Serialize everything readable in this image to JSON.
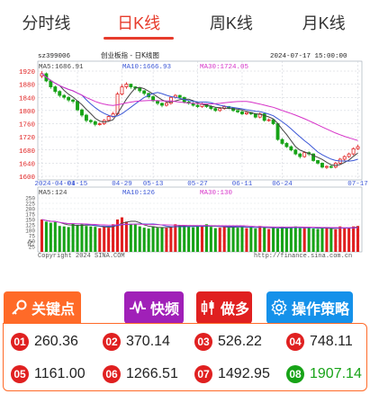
{
  "tabs": [
    {
      "label": "分时线",
      "active": false
    },
    {
      "label": "日K线",
      "active": true
    },
    {
      "label": "周K线",
      "active": false
    },
    {
      "label": "月K线",
      "active": false
    }
  ],
  "chart_header": {
    "code": "sz399006",
    "name": "创业板指 - 日K线图",
    "datetime": "2024-07-17 15:00:00",
    "ma5": "MA5:1686.91",
    "ma10": "MA10:1666.93",
    "ma30": "MA30:1724.05"
  },
  "price_axis": [
    "1920",
    "1880",
    "1840",
    "1800",
    "1760",
    "1720",
    "1680",
    "1640",
    "1600"
  ],
  "date_axis": [
    "2024-04-01",
    "04-15",
    "04-29",
    "05-13",
    "05-27",
    "06-11",
    "06-24",
    "07-17"
  ],
  "volume_header": {
    "ma5": "MA5:124",
    "ma10": "MA10:126",
    "ma30": "MA30:130"
  },
  "volume_axis": [
    "250",
    "225",
    "200",
    "175",
    "150",
    "125",
    "100",
    "75",
    "50",
    "25"
  ],
  "volume_unit": "亿",
  "copyright": "Copyright 2024 SINA.COM",
  "source_url": "http://finance.sina.com.cn",
  "toolbar": {
    "key_points": "关键点",
    "quick": "快频",
    "more": "做多",
    "strategy": "操作策略"
  },
  "key_points": [
    {
      "id": "01",
      "value": "260.36"
    },
    {
      "id": "02",
      "value": "370.14"
    },
    {
      "id": "03",
      "value": "526.22"
    },
    {
      "id": "04",
      "value": "748.11"
    },
    {
      "id": "05",
      "value": "1161.00"
    },
    {
      "id": "06",
      "value": "1266.51"
    },
    {
      "id": "07",
      "value": "1492.95"
    },
    {
      "id": "08",
      "value": "1907.14"
    }
  ],
  "colors": {
    "up": "#e02020",
    "down": "#17a317",
    "ma5": "#444444",
    "ma10": "#3a56d6",
    "ma30": "#d632c8"
  },
  "chart_data": {
    "type": "candlestick",
    "x": [
      "2024-04-01",
      "04-02",
      "04-03",
      "04-08",
      "04-09",
      "04-10",
      "04-11",
      "04-12",
      "04-15",
      "04-16",
      "04-17",
      "04-18",
      "04-19",
      "04-22",
      "04-23",
      "04-24",
      "04-25",
      "04-26",
      "04-29",
      "04-30",
      "05-06",
      "05-07",
      "05-08",
      "05-09",
      "05-10",
      "05-13",
      "05-14",
      "05-15",
      "05-16",
      "05-17",
      "05-20",
      "05-21",
      "05-22",
      "05-23",
      "05-24",
      "05-27",
      "05-28",
      "05-29",
      "05-30",
      "05-31",
      "06-03",
      "06-04",
      "06-05",
      "06-06",
      "06-07",
      "06-11",
      "06-12",
      "06-13",
      "06-14",
      "06-17",
      "06-18",
      "06-19",
      "06-20",
      "06-21",
      "06-24",
      "06-25",
      "06-26",
      "06-27",
      "06-28",
      "07-01",
      "07-02",
      "07-03",
      "07-04",
      "07-05",
      "07-08",
      "07-09",
      "07-10",
      "07-11",
      "07-12",
      "07-15",
      "07-16",
      "07-17"
    ],
    "open": [
      1905,
      1912,
      1890,
      1872,
      1858,
      1846,
      1840,
      1832,
      1828,
      1802,
      1786,
      1770,
      1766,
      1758,
      1760,
      1770,
      1782,
      1790,
      1850,
      1872,
      1880,
      1872,
      1868,
      1860,
      1852,
      1842,
      1830,
      1822,
      1816,
      1822,
      1840,
      1846,
      1840,
      1826,
      1822,
      1816,
      1812,
      1820,
      1812,
      1806,
      1800,
      1806,
      1812,
      1808,
      1800,
      1796,
      1790,
      1794,
      1790,
      1780,
      1790,
      1770,
      1772,
      1760,
      1712,
      1700,
      1690,
      1680,
      1668,
      1660,
      1672,
      1668,
      1648,
      1640,
      1628,
      1630,
      1628,
      1640,
      1652,
      1660,
      1668,
      1684
    ],
    "close": [
      1912,
      1890,
      1872,
      1858,
      1846,
      1840,
      1832,
      1828,
      1802,
      1786,
      1770,
      1766,
      1758,
      1760,
      1770,
      1782,
      1790,
      1850,
      1872,
      1880,
      1872,
      1868,
      1860,
      1852,
      1842,
      1830,
      1822,
      1816,
      1822,
      1840,
      1846,
      1840,
      1826,
      1822,
      1816,
      1812,
      1820,
      1812,
      1806,
      1800,
      1806,
      1812,
      1808,
      1800,
      1796,
      1790,
      1794,
      1790,
      1780,
      1790,
      1770,
      1772,
      1760,
      1712,
      1700,
      1690,
      1680,
      1668,
      1660,
      1672,
      1668,
      1648,
      1640,
      1628,
      1630,
      1628,
      1640,
      1652,
      1660,
      1668,
      1684,
      1690
    ],
    "high": [
      1920,
      1916,
      1894,
      1876,
      1862,
      1850,
      1844,
      1836,
      1830,
      1806,
      1790,
      1774,
      1770,
      1764,
      1774,
      1786,
      1796,
      1856,
      1880,
      1886,
      1882,
      1874,
      1870,
      1862,
      1854,
      1846,
      1832,
      1824,
      1826,
      1844,
      1850,
      1848,
      1842,
      1830,
      1826,
      1820,
      1824,
      1822,
      1816,
      1810,
      1810,
      1816,
      1814,
      1810,
      1802,
      1800,
      1798,
      1796,
      1792,
      1794,
      1792,
      1776,
      1774,
      1762,
      1716,
      1704,
      1694,
      1684,
      1672,
      1676,
      1676,
      1670,
      1650,
      1642,
      1634,
      1634,
      1644,
      1656,
      1664,
      1672,
      1688,
      1696
    ],
    "low": [
      1898,
      1886,
      1866,
      1852,
      1840,
      1834,
      1826,
      1822,
      1798,
      1780,
      1764,
      1760,
      1752,
      1754,
      1756,
      1766,
      1778,
      1786,
      1846,
      1866,
      1866,
      1862,
      1854,
      1846,
      1836,
      1826,
      1816,
      1810,
      1812,
      1818,
      1836,
      1836,
      1822,
      1818,
      1812,
      1808,
      1808,
      1808,
      1802,
      1796,
      1796,
      1802,
      1804,
      1796,
      1792,
      1786,
      1786,
      1786,
      1776,
      1776,
      1766,
      1766,
      1756,
      1708,
      1696,
      1686,
      1676,
      1664,
      1654,
      1656,
      1662,
      1644,
      1636,
      1624,
      1622,
      1624,
      1624,
      1636,
      1648,
      1656,
      1664,
      1680
    ],
    "volume": [
      150,
      140,
      135,
      138,
      120,
      118,
      115,
      130,
      125,
      128,
      120,
      118,
      116,
      110,
      115,
      112,
      128,
      150,
      160,
      140,
      130,
      128,
      118,
      112,
      108,
      118,
      112,
      115,
      110,
      118,
      128,
      124,
      120,
      118,
      114,
      118,
      120,
      128,
      116,
      110,
      112,
      118,
      112,
      120,
      112,
      118,
      110,
      114,
      108,
      120,
      112,
      106,
      110,
      108,
      116,
      112,
      112,
      118,
      110,
      110,
      114,
      108,
      106,
      112,
      110,
      108,
      104,
      118,
      110,
      112,
      118,
      120
    ],
    "ylim": [
      1600,
      1920
    ],
    "volume_ylim": [
      0,
      250
    ]
  }
}
